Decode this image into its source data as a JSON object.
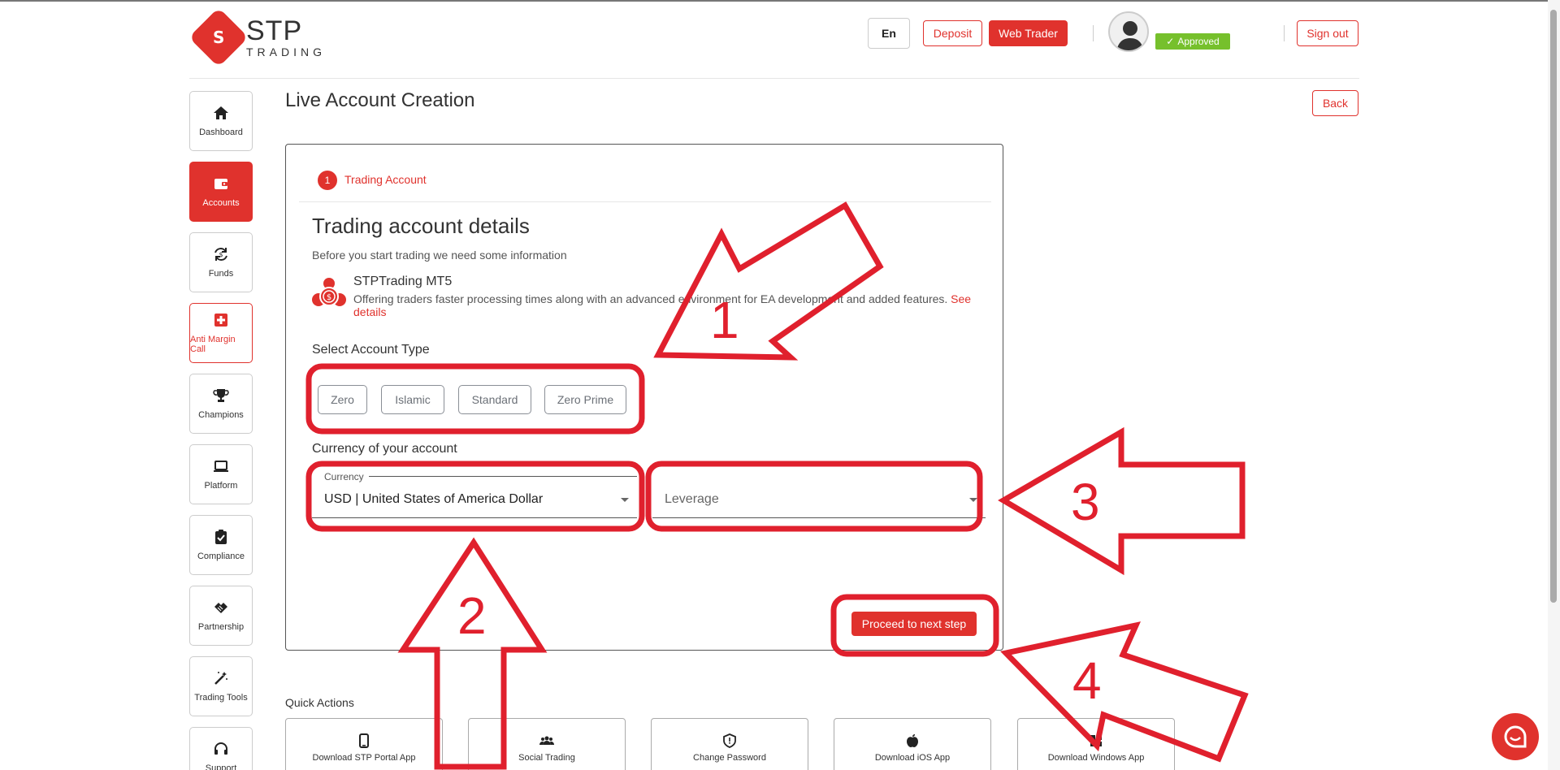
{
  "brand": {
    "name": "STP",
    "sub": "TRADING",
    "mark": "S"
  },
  "header": {
    "lang": "En",
    "deposit": "Deposit",
    "web_trader": "Web Trader",
    "status": "Approved",
    "sign_out": "Sign out"
  },
  "sidebar": {
    "items": [
      {
        "label": "Dashboard",
        "icon": "home-icon"
      },
      {
        "label": "Accounts",
        "icon": "wallet-icon"
      },
      {
        "label": "Funds",
        "icon": "funds-cycle-icon"
      },
      {
        "label": "Anti Margin Call",
        "icon": "medical-cross-icon"
      },
      {
        "label": "Champions",
        "icon": "trophy-icon"
      },
      {
        "label": "Platform",
        "icon": "laptop-icon"
      },
      {
        "label": "Compliance",
        "icon": "clipboard-check-icon"
      },
      {
        "label": "Partnership",
        "icon": "handshake-icon"
      },
      {
        "label": "Trading Tools",
        "icon": "magic-wand-icon"
      },
      {
        "label": "Support",
        "icon": "headset-icon"
      }
    ]
  },
  "main": {
    "title": "Live Account Creation",
    "back": "Back",
    "step": {
      "number": "1",
      "label": "Trading Account"
    },
    "card_title": "Trading account details",
    "card_sub": "Before you start trading we need some information",
    "platform": {
      "name": "STPTrading MT5",
      "desc": "Offering traders faster processing times along with an advanced environment for EA development and added features.",
      "link": "See details"
    },
    "account_type_label": "Select Account Type",
    "account_types": [
      "Zero",
      "Islamic",
      "Standard",
      "Zero Prime"
    ],
    "currency_label": "Currency of your account",
    "currency_field": {
      "label": "Currency",
      "value": "USD | United States of America Dollar"
    },
    "leverage_field": {
      "placeholder": "Leverage"
    },
    "proceed": "Proceed to next step"
  },
  "quick_actions": {
    "title": "Quick Actions",
    "items": [
      {
        "label": "Download STP Portal App",
        "icon": "phone-icon"
      },
      {
        "label": "Social Trading",
        "icon": "people-icon"
      },
      {
        "label": "Change Password",
        "icon": "shield-icon"
      },
      {
        "label": "Download iOS App",
        "icon": "apple-icon"
      },
      {
        "label": "Download Windows App",
        "icon": "windows-icon"
      }
    ]
  },
  "annotations": [
    "1",
    "2",
    "3",
    "4"
  ],
  "colors": {
    "brand_red": "#e0322d",
    "approved_green": "#76c02c",
    "annotation_red": "#e0202d"
  }
}
